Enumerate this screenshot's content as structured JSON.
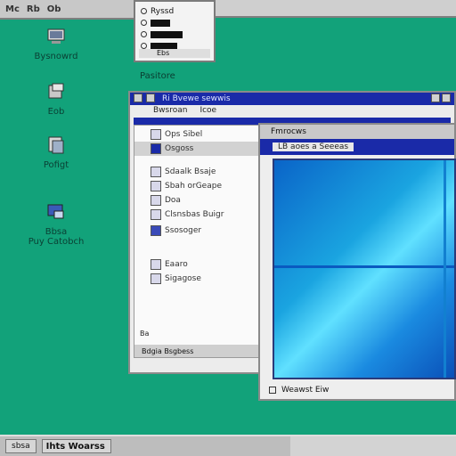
{
  "topbar": {
    "items": [
      "Mc",
      "Rb",
      "Ob"
    ]
  },
  "desktop_icons": [
    {
      "name": "icon-1",
      "label": "Bysnowrd"
    },
    {
      "name": "icon-2",
      "label": "Eob"
    },
    {
      "name": "icon-3",
      "label": "Pofigt"
    },
    {
      "name": "icon-4",
      "label": "Bbsa\nPuy Catobch"
    }
  ],
  "popup": {
    "rows": [
      "Ryssd",
      "",
      "",
      ""
    ],
    "footer": "Ebs"
  },
  "desktop_label": "Pasitore",
  "main_window": {
    "title": "Ri Bvewe sewwis",
    "menu": [
      "Bwsroan",
      "Icoe"
    ],
    "side_items": [
      "Ops Sibel",
      "Osgoss",
      "Sdaalk Bsaje",
      "Sbah orGeape",
      "Doa",
      "Clsnsbas Buigr",
      "Ssosoger",
      "Eaaro",
      "Sigagose"
    ],
    "corner_text": "Ba",
    "status": "Bdgia Bsgbess"
  },
  "preview_window": {
    "title": "Fmrocws",
    "tab": "LB  aoes a Seeeas",
    "footer": "Weawst Eiw"
  },
  "taskbar": {
    "start": "sbsa",
    "task": "Ihts Woarss"
  },
  "colors": {
    "desktop": "#12a27a",
    "titlebar": "#1a2aa8"
  }
}
